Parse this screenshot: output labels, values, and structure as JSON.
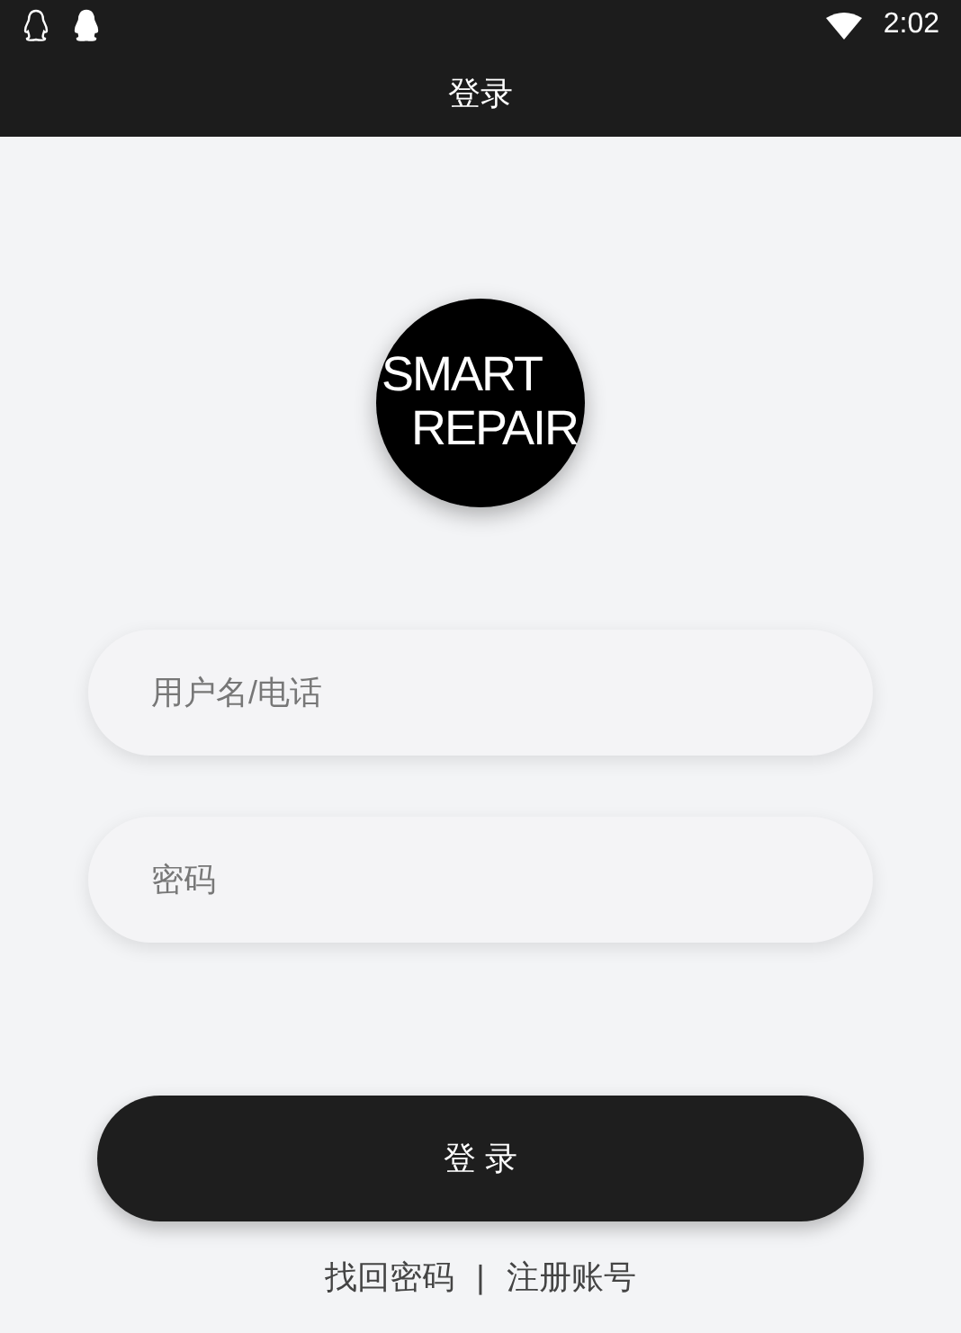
{
  "status_bar": {
    "time": "2:02"
  },
  "header": {
    "title": "登录"
  },
  "logo": {
    "line_1": "SMART",
    "line_2": "REPAIR"
  },
  "fields": [
    {
      "placeholder": "用户名/电话"
    },
    {
      "placeholder": "密码"
    }
  ],
  "login_button": "登 录",
  "links": [
    {
      "label": "找回密码"
    },
    {
      "label": "注册账号"
    }
  ],
  "separator": "|"
}
